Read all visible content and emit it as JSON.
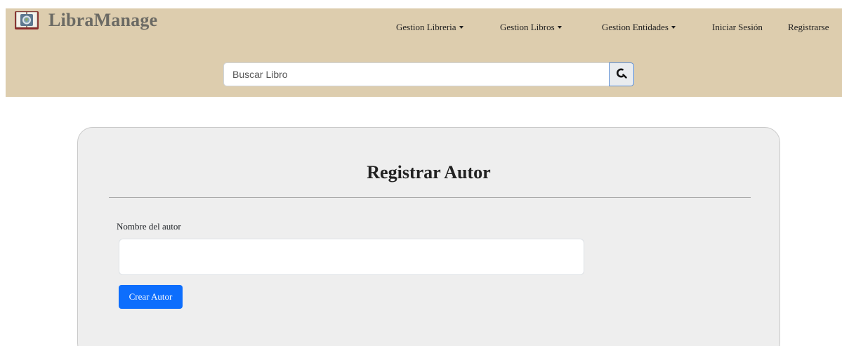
{
  "brand": {
    "name": "LibraManage",
    "logo_icon": "open-book-globe-icon"
  },
  "nav": {
    "items": [
      {
        "label": "Gestion Libreria",
        "dropdown": true
      },
      {
        "label": "Gestion Libros",
        "dropdown": true
      },
      {
        "label": "Gestion Entidades",
        "dropdown": true
      },
      {
        "label": "Iniciar Sesión",
        "dropdown": false
      },
      {
        "label": "Registrarse",
        "dropdown": false
      }
    ]
  },
  "search": {
    "placeholder": "Buscar Libro",
    "value": "",
    "button_icon": "search-icon"
  },
  "form": {
    "title": "Registrar Autor",
    "name_label": "Nombre del autor",
    "name_value": "",
    "submit_label": "Crear Autor"
  },
  "colors": {
    "navbar_bg": "#ddcdae",
    "brand_text": "#6b6a64",
    "card_bg": "#eeeeee",
    "primary_button": "#0d6efd"
  }
}
